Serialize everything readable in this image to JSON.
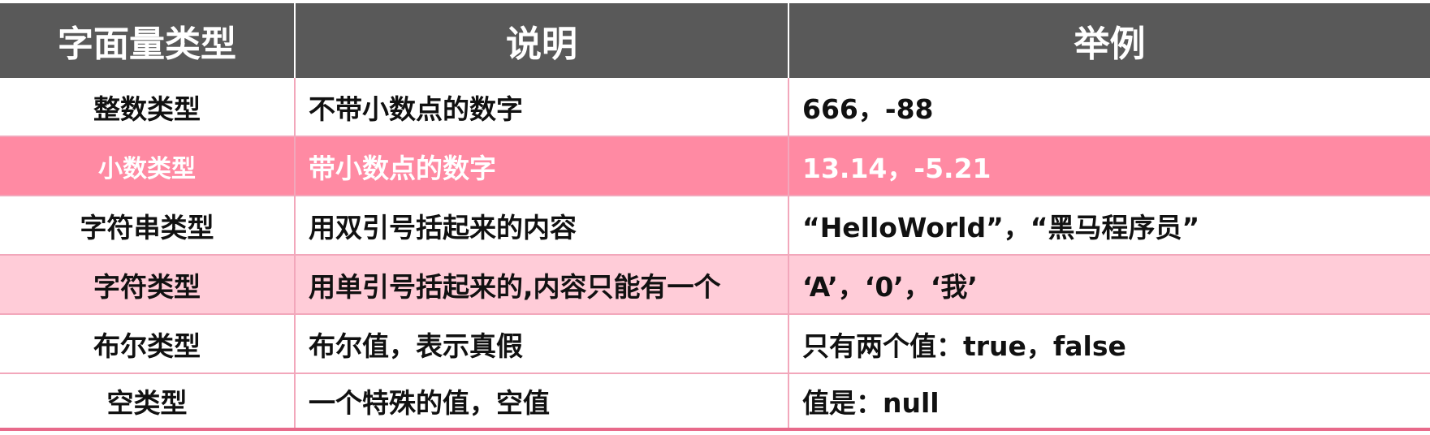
{
  "table": {
    "headers": [
      "字面量类型",
      "说明",
      "举例"
    ],
    "rows": [
      {
        "type": "整数类型",
        "desc": "不带小数点的数字",
        "example": "666，-88"
      },
      {
        "type": "小数类型",
        "desc": "带小数点的数字",
        "example": "13.14，-5.21"
      },
      {
        "type": "字符串类型",
        "desc": "用双引号括起来的内容",
        "example": "“HelloWorld”，“黑马程序员”"
      },
      {
        "type": "字符类型",
        "desc": "用单引号括起来的,内容只能有一个",
        "example": "‘A’，‘0’，‘我’"
      },
      {
        "type": "布尔类型",
        "desc": "布尔值，表示真假",
        "example": "只有两个值：true，false"
      },
      {
        "type": "空类型",
        "desc": "一个特殊的值，空值",
        "example": "值是：null"
      }
    ]
  },
  "colors": {
    "header_bg": "#595959",
    "highlight_row": "#ff8aa3",
    "light_row": "#ffccd8",
    "border": "#f2a7bb"
  }
}
